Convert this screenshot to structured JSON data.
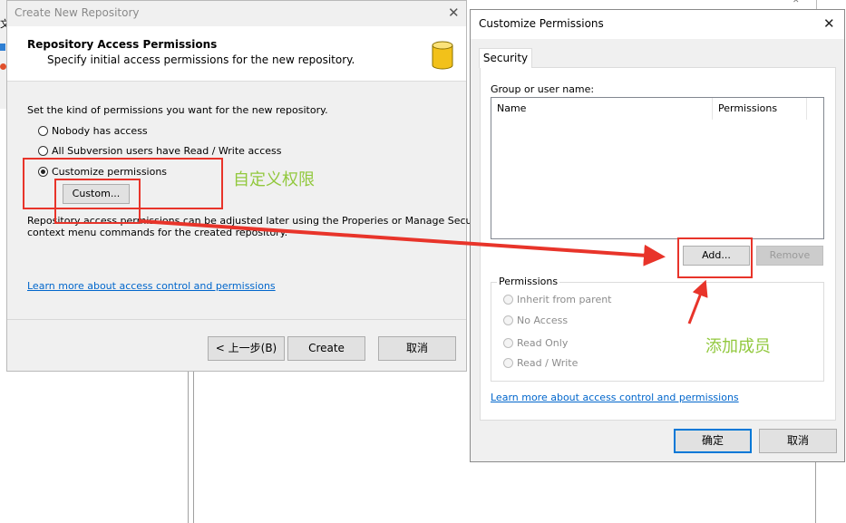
{
  "background": {
    "partial_label": "文"
  },
  "wizard": {
    "title": "Create New Repository",
    "header_title": "Repository Access Permissions",
    "header_subtitle": "Specify initial access permissions for the new repository.",
    "instruction": "Set the kind of permissions you want for the new repository.",
    "options": [
      {
        "label": "Nobody has access",
        "selected": false
      },
      {
        "label": "All Subversion users have Read / Write access",
        "selected": false
      },
      {
        "label": "Customize permissions",
        "selected": true
      }
    ],
    "custom_button": "Custom...",
    "note_line1": "Repository access permissions can be adjusted later using the Properies or Manage Security",
    "note_line2": "context menu commands for the created repository.",
    "learn_link": "Learn more about access control and permissions",
    "buttons": {
      "back": "< 上一步(B)",
      "create": "Create",
      "cancel": "取消"
    }
  },
  "permissions_dialog": {
    "title": "Customize Permissions",
    "tab": "Security",
    "group_label": "Group or user name:",
    "columns": [
      "Name",
      "Permissions"
    ],
    "add_button": "Add...",
    "remove_button": "Remove",
    "permissions_group": "Permissions",
    "permission_options": [
      "Inherit from parent",
      "No Access",
      "Read Only",
      "Read / Write"
    ],
    "learn_link": "Learn more about access control and permissions",
    "ok_button": "确定",
    "cancel_button": "取消"
  },
  "annotations": {
    "custom_note": "自定义权限",
    "add_note": "添加成员"
  },
  "colors": {
    "annotation_text": "#92c83e",
    "annotation_box": "#e8342a",
    "link": "#0066cc",
    "default_button_border": "#0078d7"
  }
}
